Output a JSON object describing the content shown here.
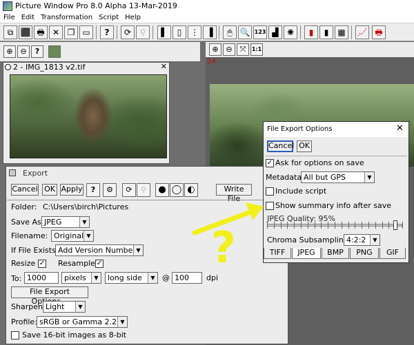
{
  "app": {
    "title": "Picture Window Pro 8.0 Alpha 13-Mar-2019"
  },
  "menu": [
    "File",
    "Edit",
    "Transformation",
    "Script",
    "Help"
  ],
  "image_window": {
    "title": "2 - IMG_1813 v2.tif"
  },
  "viewer": {
    "zoom_label": "1:1",
    "number": "24"
  },
  "export": {
    "title": "Export",
    "cancel": "Cancel",
    "ok": "OK",
    "apply": "Apply",
    "help": "?",
    "write_file": "Write File",
    "folder_label": "Folder:",
    "folder_value": "C:\\Users\\birch\\Pictures",
    "save_as_label": "Save As:",
    "save_as_value": "JPEG",
    "filename_label": "Filename:",
    "filename_value": "Original",
    "if_exists_label": "If File Exists:",
    "if_exists_value": "Add Version Number",
    "resize_label": "Resize",
    "resample_label": "Resample",
    "to_label": "To:",
    "to_value": "1000",
    "units_value": "pixels",
    "side_value": "long side",
    "at": "@",
    "dpi_value": "100",
    "dpi_label": "dpi",
    "options_button": "File Export Options...",
    "sharpen_label": "Sharpen:",
    "sharpen_value": "Light",
    "profile_label": "Profile:",
    "profile_value": "sRGB or Gamma 2.2",
    "save16_label": "Save 16-bit images as 8-bit"
  },
  "feo": {
    "title": "File Export Options",
    "cancel": "Cancel",
    "ok": "OK",
    "ask_label": "Ask for options on save",
    "metadata_label": "Metadata:",
    "metadata_value": "All but GPS",
    "include_script_label": "Include script",
    "summary_label": "Show summary info after save",
    "quality_label": "JPEG Quality: 95%",
    "quality_value": 95,
    "chroma_label": "Chroma Subsampling:",
    "chroma_value": "4:2:2",
    "tabs": [
      "TIFF",
      "JPEG",
      "BMP",
      "PNG",
      "GIF"
    ],
    "active_tab": "JPEG"
  },
  "annotation": {
    "question_mark": "?",
    "color": "#f2ef1a"
  },
  "colors": {
    "accent": "#f2ef1a",
    "selection": "#2a5fb3",
    "number": "#d00000"
  }
}
